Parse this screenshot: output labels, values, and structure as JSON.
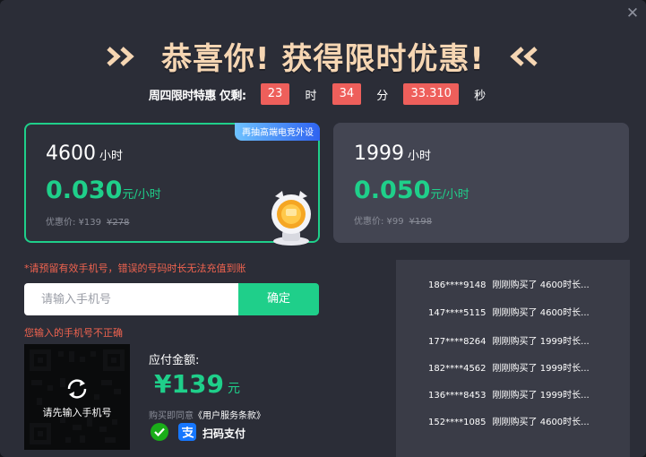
{
  "close_icon": "close-icon",
  "headline": {
    "title": "恭喜你! 获得限时优惠!",
    "left_decoration": "double-chevron-right-icon",
    "right_decoration": "double-chevron-left-icon",
    "color": "#f6d6b3"
  },
  "timer": {
    "label": "周四限时特惠 仅剩:",
    "hours": "23",
    "hours_unit": "时",
    "minutes": "34",
    "minutes_unit": "分",
    "seconds": "33.310",
    "seconds_unit": "秒"
  },
  "plans": [
    {
      "hours": "4600",
      "hours_unit": "小时",
      "rate": "0.030",
      "rate_unit": "元/小时",
      "discount_label": "优惠价: ¥139",
      "original_price": "¥278",
      "badge": "再抽高端电竞外设",
      "selected": true
    },
    {
      "hours": "1999",
      "hours_unit": "小时",
      "rate": "0.050",
      "rate_unit": "元/小时",
      "discount_label": "优惠价: ¥99",
      "original_price": "¥198",
      "selected": false
    }
  ],
  "phone_form": {
    "warning": "*请预留有效手机号，错误的号码时长无法充值到账",
    "placeholder": "请输入手机号",
    "confirm_label": "确定",
    "error": "您输入的手机号不正确"
  },
  "qr": {
    "text": "请先输入手机号"
  },
  "payment": {
    "label": "应付金额:",
    "currency": "¥",
    "amount": "139",
    "unit": "元",
    "agree_prefix": "购买即同意",
    "terms": "《用户服务条款》",
    "methods": [
      "wechat-pay-icon",
      "alipay-icon"
    ],
    "scan_label": "扫码支付"
  },
  "purchase_feed": [
    {
      "phone": "186****9148",
      "text": "刚刚购买了 4600时长..."
    },
    {
      "phone": "147****5115",
      "text": "刚刚购买了 4600时长..."
    },
    {
      "phone": "177****8264",
      "text": "刚刚购买了 1999时长..."
    },
    {
      "phone": "182****4562",
      "text": "刚刚购买了 1999时长..."
    },
    {
      "phone": "136****8453",
      "text": "刚刚购买了 1999时长..."
    },
    {
      "phone": "152****1085",
      "text": "刚刚购买了 4600时长..."
    }
  ],
  "colors": {
    "accent": "#1fcf8a",
    "alert": "#ee5f5b",
    "background": "#2b2d37"
  }
}
